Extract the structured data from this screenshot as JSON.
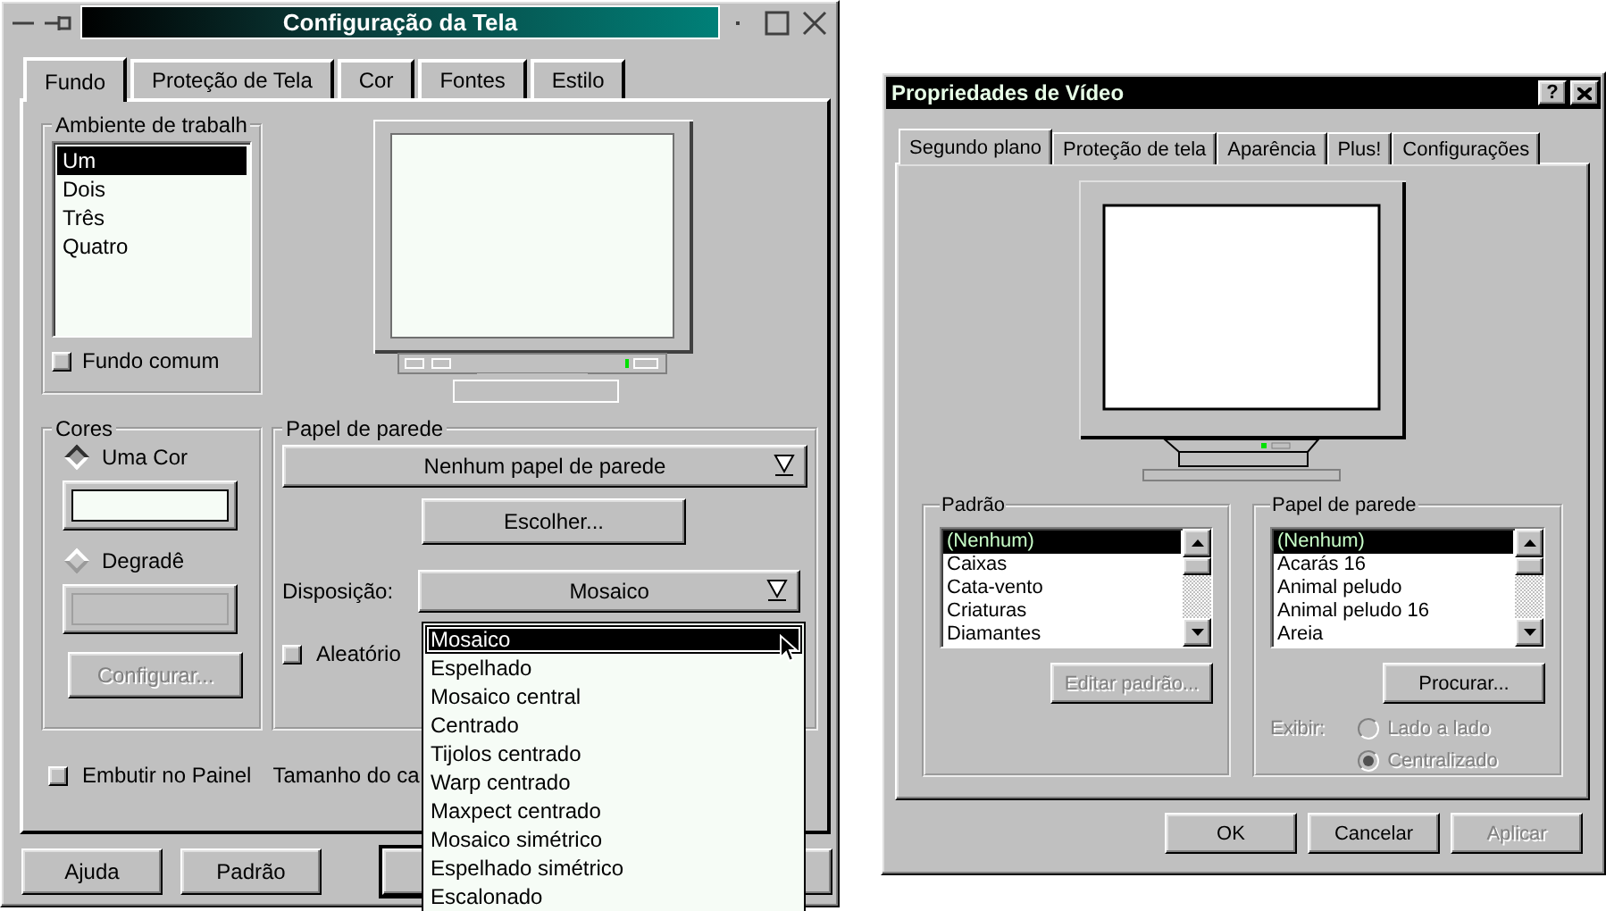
{
  "config_window": {
    "title": "Configuração da Tela",
    "tabs": [
      {
        "label": "Fundo",
        "selected": true
      },
      {
        "label": "Proteção de Tela",
        "selected": false
      },
      {
        "label": "Cor",
        "selected": false
      },
      {
        "label": "Fontes",
        "selected": false
      },
      {
        "label": "Estilo",
        "selected": false
      }
    ],
    "desktops": {
      "title": "Ambiente de trabalh",
      "items": [
        {
          "label": "Um",
          "selected": true
        },
        {
          "label": "Dois",
          "selected": false
        },
        {
          "label": "Três",
          "selected": false
        },
        {
          "label": "Quatro",
          "selected": false
        }
      ],
      "common_background": {
        "label": "Fundo comum",
        "checked": false
      }
    },
    "colors": {
      "title": "Cores",
      "options": [
        {
          "label": "Uma Cor",
          "selected": true,
          "swatch_disabled": false
        },
        {
          "label": "Degradê",
          "selected": false,
          "swatch_disabled": true
        }
      ],
      "configure_button": {
        "label": "Configurar...",
        "disabled": true
      }
    },
    "wallpaper": {
      "title": "Papel de parede",
      "select": "Nenhum papel de parede",
      "choose_button": "Escolher...",
      "arrangement_label": "Disposição:",
      "arrangement_value": "Mosaico",
      "random": {
        "label": "Aleatório",
        "checked": false
      },
      "arrangement_options": [
        {
          "label": "Mosaico",
          "selected": true
        },
        {
          "label": "Espelhado",
          "selected": false
        },
        {
          "label": "Mosaico central",
          "selected": false
        },
        {
          "label": "Centrado",
          "selected": false
        },
        {
          "label": "Tijolos centrado",
          "selected": false
        },
        {
          "label": "Warp centrado",
          "selected": false
        },
        {
          "label": "Maxpect centrado",
          "selected": false
        },
        {
          "label": "Mosaico simétrico",
          "selected": false
        },
        {
          "label": "Espelhado simétrico",
          "selected": false
        },
        {
          "label": "Escalonado",
          "selected": false
        }
      ]
    },
    "dock": {
      "label": "Embutir no Painel",
      "checked": false
    },
    "size_label": "Tamanho do ca",
    "buttons": [
      {
        "label": "Ajuda"
      },
      {
        "label": "Padrão"
      }
    ]
  },
  "properties_window": {
    "title": "Propriedades de Vídeo",
    "help_button": "?",
    "tabs": [
      {
        "label": "Segundo plano",
        "selected": true
      },
      {
        "label": "Proteção de tela",
        "selected": false
      },
      {
        "label": "Aparência",
        "selected": false
      },
      {
        "label": "Plus!",
        "selected": false
      },
      {
        "label": "Configurações",
        "selected": false
      }
    ],
    "pattern": {
      "title": "Padrão",
      "items": [
        {
          "label": "(Nenhum)",
          "selected": true
        },
        {
          "label": "Caixas",
          "selected": false
        },
        {
          "label": "Cata-vento",
          "selected": false
        },
        {
          "label": "Criaturas",
          "selected": false
        },
        {
          "label": "Diamantes",
          "selected": false
        }
      ],
      "edit_button": {
        "label": "Editar padrão...",
        "disabled": true
      }
    },
    "wallpaper": {
      "title": "Papel de parede",
      "items": [
        {
          "label": "(Nenhum)",
          "selected": true
        },
        {
          "label": "Acarás 16",
          "selected": false
        },
        {
          "label": "Animal peludo",
          "selected": false
        },
        {
          "label": "Animal peludo 16",
          "selected": false
        },
        {
          "label": "Areia",
          "selected": false
        }
      ],
      "browse_button": "Procurar...",
      "display_label": "Exibir:",
      "display_disabled": true,
      "display_options": [
        {
          "label": "Lado a lado",
          "selected": false
        },
        {
          "label": "Centralizado",
          "selected": true
        }
      ]
    },
    "buttons": [
      {
        "label": "OK",
        "disabled": false
      },
      {
        "label": "Cancelar",
        "disabled": false
      },
      {
        "label": "Aplicar",
        "disabled": true
      }
    ]
  }
}
